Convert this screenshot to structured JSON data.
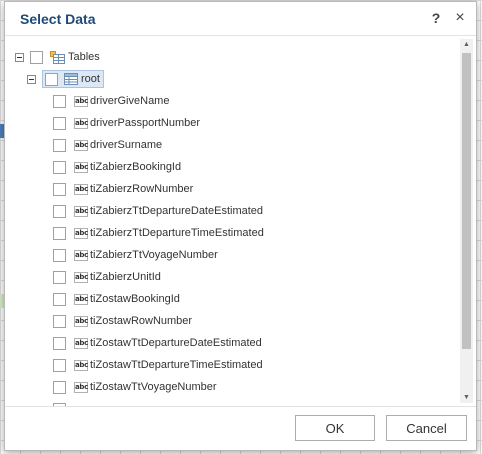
{
  "dialog": {
    "title": "Select Data",
    "help_label": "?",
    "close_label": "×"
  },
  "tree": {
    "tables_label": "Tables",
    "root_label": "root",
    "field_icon_label": "abc",
    "fields": [
      {
        "label": "driverGiveName"
      },
      {
        "label": "driverPassportNumber"
      },
      {
        "label": "driverSurname"
      },
      {
        "label": "tiZabierzBookingId"
      },
      {
        "label": "tiZabierzRowNumber"
      },
      {
        "label": "tiZabierzTtDepartureDateEstimated"
      },
      {
        "label": "tiZabierzTtDepartureTimeEstimated"
      },
      {
        "label": "tiZabierzTtVoyageNumber"
      },
      {
        "label": "tiZabierzUnitId"
      },
      {
        "label": "tiZostawBookingId"
      },
      {
        "label": "tiZostawRowNumber"
      },
      {
        "label": "tiZostawTtDepartureDateEstimated"
      },
      {
        "label": "tiZostawTtDepartureTimeEstimated"
      },
      {
        "label": "tiZostawTtVoyageNumber"
      }
    ]
  },
  "scrollbar": {
    "up_arrow": "▲",
    "down_arrow": "▼"
  },
  "footer": {
    "ok_label": "OK",
    "cancel_label": "Cancel"
  },
  "colors": {
    "title": "#1e4a78",
    "selected_bg": "#dce8f6",
    "background_highlight": "#e8f4e0",
    "background_edge_blue": "#4a7fc0"
  }
}
